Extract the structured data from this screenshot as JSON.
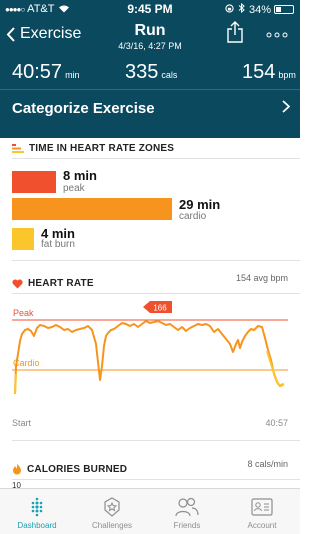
{
  "status_bar": {
    "carrier": "AT&T",
    "time": "9:45 PM",
    "battery": "34%",
    "battery_level": 0.34
  },
  "nav": {
    "back_label": "Exercise",
    "title": "Run",
    "subtitle": "4/3/16, 4:27 PM"
  },
  "summary": {
    "duration_value": "40:57",
    "duration_unit": "min",
    "calories_value": "335",
    "calories_unit": "cals",
    "heart_rate_value": "154",
    "heart_rate_unit": "bpm"
  },
  "categorize": {
    "label": "Categorize Exercise"
  },
  "zones": {
    "title": "TIME IN HEART RATE ZONES",
    "items": [
      {
        "value": "8 min",
        "name": "peak",
        "minutes": 8,
        "color": "#f0502e"
      },
      {
        "value": "29 min",
        "name": "cardio",
        "minutes": 29,
        "color": "#f7941d"
      },
      {
        "value": "4 min",
        "name": "fat burn",
        "minutes": 4,
        "color": "#fbc52c"
      }
    ]
  },
  "heart_rate": {
    "title": "HEART RATE",
    "avg": "154 avg bpm",
    "peak_label": "Peak",
    "cardio_label": "Cardio",
    "max_marker": "166",
    "start_label": "Start",
    "end_label": "40:57"
  },
  "calories": {
    "title": "CALORIES BURNED",
    "rate": "8 cals/min",
    "axis_value": "10"
  },
  "tabs": [
    {
      "label": "Dashboard",
      "icon": "dashboard-icon",
      "active": true
    },
    {
      "label": "Challenges",
      "icon": "challenges-icon",
      "active": false
    },
    {
      "label": "Friends",
      "icon": "friends-icon",
      "active": false
    },
    {
      "label": "Account",
      "icon": "account-icon",
      "active": false
    }
  ],
  "colors": {
    "header": "#0b4a5e",
    "accent": "#1aa2b4",
    "peak": "#f0502e",
    "cardio": "#f7941d",
    "fat_burn": "#fbc52c"
  }
}
